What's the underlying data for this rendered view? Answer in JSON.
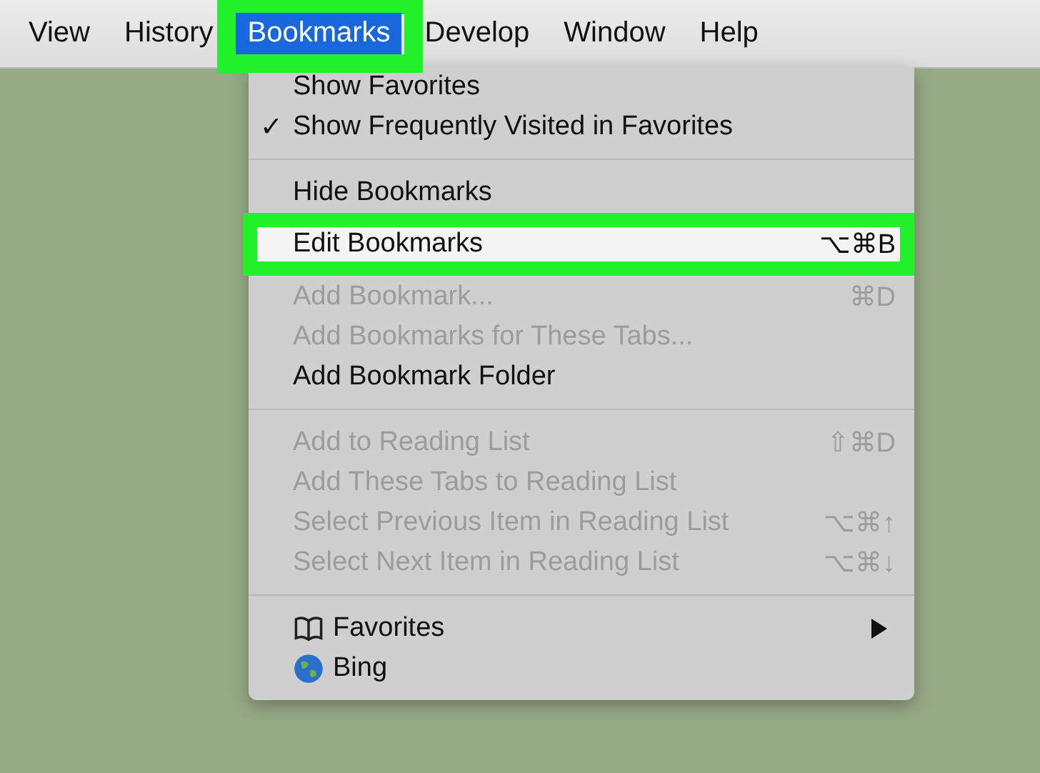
{
  "menubar": [
    {
      "label": "View",
      "selected": false,
      "callout": false
    },
    {
      "label": "History",
      "selected": false,
      "callout": false
    },
    {
      "label": "Bookmarks",
      "selected": true,
      "callout": true
    },
    {
      "label": "Develop",
      "selected": false,
      "callout": false
    },
    {
      "label": "Window",
      "selected": false,
      "callout": false
    },
    {
      "label": "Help",
      "selected": false,
      "callout": false
    }
  ],
  "menu": {
    "items": [
      {
        "kind": "item",
        "label": "Show Favorites",
        "disabled": false,
        "checked": false
      },
      {
        "kind": "item",
        "label": "Show Frequently Visited in Favorites",
        "disabled": false,
        "checked": true,
        "check_glyph": "✓"
      },
      {
        "kind": "separator"
      },
      {
        "kind": "item",
        "label": "Hide Bookmarks",
        "disabled": false,
        "checked": false
      },
      {
        "kind": "item",
        "label": "Edit Bookmarks",
        "shortcut": "⌥⌘B",
        "disabled": false,
        "checked": false,
        "callout": true
      },
      {
        "kind": "item",
        "label": "Add Bookmark...",
        "shortcut": "⌘D",
        "disabled": true,
        "checked": false
      },
      {
        "kind": "item",
        "label": "Add Bookmarks for These Tabs...",
        "disabled": true,
        "checked": false
      },
      {
        "kind": "item",
        "label": "Add Bookmark Folder",
        "disabled": false,
        "checked": false
      },
      {
        "kind": "separator"
      },
      {
        "kind": "item",
        "label": "Add to Reading List",
        "shortcut": "⇧⌘D",
        "disabled": true,
        "checked": false
      },
      {
        "kind": "item",
        "label": "Add These Tabs to Reading List",
        "disabled": true,
        "checked": false
      },
      {
        "kind": "item",
        "label": "Select Previous Item in Reading List",
        "shortcut": "⌥⌘↑",
        "disabled": true,
        "checked": false
      },
      {
        "kind": "item",
        "label": "Select Next Item in Reading List",
        "shortcut": "⌥⌘↓",
        "disabled": true,
        "checked": false
      },
      {
        "kind": "separator"
      },
      {
        "kind": "folder",
        "label": "Favorites",
        "submenu": true
      },
      {
        "kind": "link",
        "label": "Bing"
      }
    ]
  }
}
